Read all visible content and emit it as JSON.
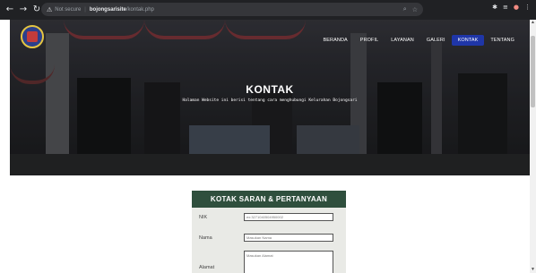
{
  "browser": {
    "security_label": "Not secure",
    "host": "bojongsarisite",
    "path": "/kontak.php"
  },
  "nav": {
    "items": [
      {
        "label": "BERANDA",
        "active": false
      },
      {
        "label": "PROFIL",
        "active": false
      },
      {
        "label": "LAYANAN",
        "active": false
      },
      {
        "label": "GALERI",
        "active": false
      },
      {
        "label": "KONTAK",
        "active": true
      },
      {
        "label": "TENTANG",
        "active": false
      }
    ]
  },
  "hero": {
    "title": "KONTAK",
    "subtitle": "Halaman Website ini berisi tentang cara menghubungi Kelurahan Bojongsari"
  },
  "form": {
    "title": "KOTAK SARAN & PERTANYAAN",
    "fields": [
      {
        "label": "NIK",
        "value": "ex:3271040504950002"
      },
      {
        "label": "Nama",
        "value": "Masukan Nama"
      },
      {
        "label": "Alamat",
        "value": "Masukan Alamat"
      }
    ]
  },
  "colors": {
    "chrome_bg": "#202124",
    "nav_active": "#1f36a8",
    "form_header": "#2f4f3d",
    "form_bg": "#e9eae6"
  }
}
